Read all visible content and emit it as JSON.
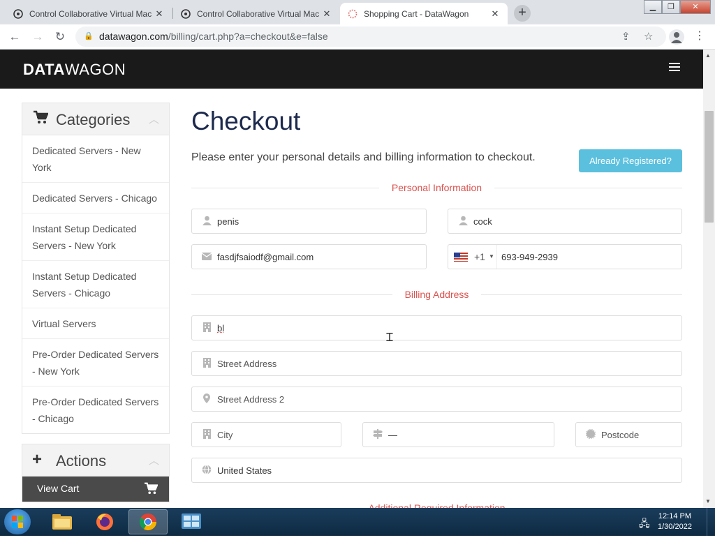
{
  "browser": {
    "tabs": [
      {
        "title": "Control Collaborative Virtual Mac",
        "active": false
      },
      {
        "title": "Control Collaborative Virtual Mac",
        "active": false
      },
      {
        "title": "Shopping Cart - DataWagon",
        "active": true
      }
    ],
    "url_host": "datawagon.com",
    "url_path": "/billing/cart.php?a=checkout&e=false"
  },
  "site": {
    "logo_bold": "DATA",
    "logo_light": "WAGON"
  },
  "sidebar": {
    "categories_title": "Categories",
    "categories": [
      "Dedicated Servers - New York",
      "Dedicated Servers - Chicago",
      "Instant Setup Dedicated Servers - New York",
      "Instant Setup Dedicated Servers - Chicago",
      "Virtual Servers",
      "Pre-Order Dedicated Servers - New York",
      "Pre-Order Dedicated Servers - Chicago"
    ],
    "actions_title": "Actions",
    "view_cart_label": "View Cart"
  },
  "checkout": {
    "title": "Checkout",
    "intro": "Please enter your personal details and billing information to checkout.",
    "already_registered": "Already Registered?",
    "personal_section": "Personal Information",
    "billing_section": "Billing Address",
    "additional_section": "Additional Required Information",
    "fields": {
      "first_name": "penis",
      "last_name": "cock",
      "email": "fasdjfsaiodf@gmail.com",
      "phone_dial": "+1",
      "phone_number": "693-949-2939",
      "company": "bl",
      "street_placeholder": "Street Address",
      "street2_placeholder": "Street Address 2",
      "city_placeholder": "City",
      "state_value": "—",
      "postcode_placeholder": "Postcode",
      "country": "United States"
    }
  },
  "taskbar": {
    "time": "12:14 PM",
    "date": "1/30/2022"
  },
  "colors": {
    "header_bg": "#1a1a1a",
    "section_red": "#d9534f",
    "info_button": "#5bc0de",
    "title_navy": "#1d2a4d"
  }
}
